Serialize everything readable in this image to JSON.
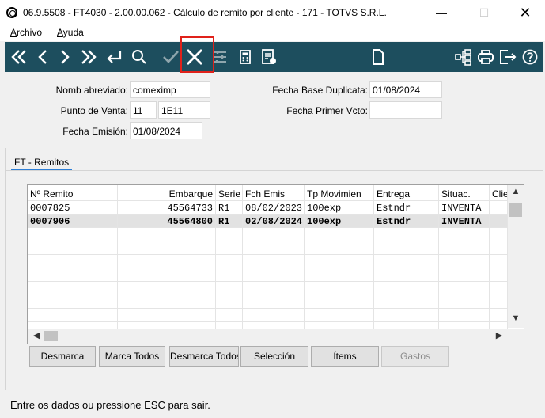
{
  "window": {
    "title": "06.9.5508 - FT4030 - 2.00.00.062 - Cálculo de remito por cliente - 171 - TOTVS S.R.L.",
    "min_glyph": "—",
    "max_glyph": "☐",
    "close_glyph": "✕"
  },
  "menu": {
    "items": [
      "Archivo",
      "Ayuda"
    ]
  },
  "toolbar": {
    "icons": [
      "first-icon",
      "prev-icon",
      "next-icon",
      "last-icon",
      "return-icon",
      "search-icon",
      "confirm-icon",
      "cancel-icon",
      "filter-icon",
      "calculator-icon",
      "report-icon",
      "document-icon",
      "tree-icon",
      "print-icon",
      "exit-icon",
      "help-icon"
    ]
  },
  "form": {
    "nomb_abreviado": {
      "label": "Nomb abreviado:",
      "value": "comeximp"
    },
    "punto_venta": {
      "label": "Punto de Venta:",
      "value1": "11",
      "value2": "1E11"
    },
    "fecha_emision": {
      "label": "Fecha Emisión:",
      "value": "01/08/2024"
    },
    "fecha_base_duplicata": {
      "label": "Fecha Base Duplicata:",
      "value": "01/08/2024"
    },
    "fecha_primer_vcto": {
      "label": "Fecha Primer Vcto:",
      "value": ""
    }
  },
  "tab": {
    "label": "FT - Remitos"
  },
  "grid": {
    "columns": [
      "Nº Remito",
      "Embarque",
      "Serie",
      "Fch Emis",
      "Tp Movimien",
      "Entrega",
      "Situac.",
      "Clien"
    ],
    "rows": [
      [
        "0007825",
        "45564733",
        "R1",
        "08/02/2023",
        "100exp",
        "Estndr",
        "INVENTA",
        ""
      ],
      [
        "0007906",
        "45564800",
        "R1",
        "02/08/2024",
        "100exp",
        "Estndr",
        "INVENTA",
        ""
      ]
    ],
    "selected_row": 1,
    "empty_rows": 8
  },
  "buttons": {
    "desmarca": "Desmarca",
    "marca_todos": "Marca Todos",
    "desmarca_todos": "Desmarca Todos",
    "seleccion": "Selección",
    "items": "Ítems",
    "gastos": "Gastos"
  },
  "status": {
    "text": "Entre os dados ou pressione ESC para sair."
  },
  "colors": {
    "toolbar_bg": "#1d4e5e",
    "highlight": "#e0211a",
    "tab_underline": "#2c7ed6"
  }
}
